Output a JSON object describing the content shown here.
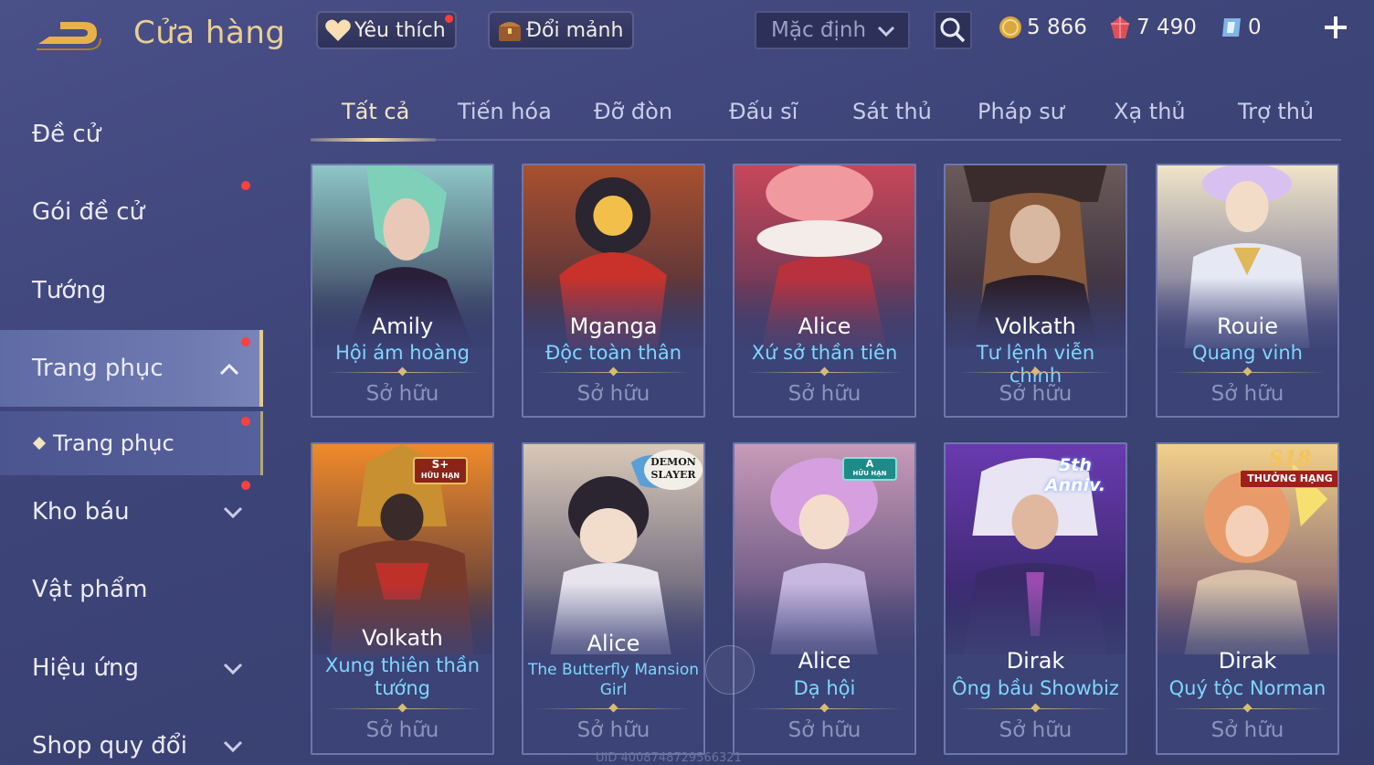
{
  "header": {
    "title": "Cửa hàng",
    "favorites_label": "Yêu thích",
    "exchange_label": "Đổi mảnh",
    "sort": {
      "selected": "Mặc định"
    },
    "currencies": [
      {
        "icon": "gold-coin-icon",
        "value": "5 866"
      },
      {
        "icon": "red-gem-icon",
        "value": "7 490"
      },
      {
        "icon": "voucher-icon",
        "value": "0"
      }
    ]
  },
  "sidebar": {
    "items": [
      {
        "label": "Đề cử"
      },
      {
        "label": "Gói đề cử"
      },
      {
        "label": "Tướng"
      },
      {
        "label": "Trang phục"
      },
      {
        "label": "Trang phục"
      },
      {
        "label": "Kho báu"
      },
      {
        "label": "Vật phẩm"
      },
      {
        "label": "Hiệu ứng"
      },
      {
        "label": "Shop quy đổi"
      }
    ]
  },
  "tabs": [
    "Tất cả",
    "Tiến hóa",
    "Đỡ đòn",
    "Đấu sĩ",
    "Sát thủ",
    "Pháp sư",
    "Xạ thủ",
    "Trợ thủ"
  ],
  "cards": [
    {
      "hero": "Amily",
      "skin": "Hội ám hoàng",
      "status": "Sở hữu"
    },
    {
      "hero": "Mganga",
      "skin": "Độc toàn thân",
      "status": "Sở hữu"
    },
    {
      "hero": "Alice",
      "skin": "Xứ sở thần tiên",
      "status": "Sở hữu"
    },
    {
      "hero": "Volkath",
      "skin": "Tư lệnh viễn chinh",
      "status": "Sở hữu"
    },
    {
      "hero": "Rouie",
      "skin": "Quang vinh",
      "status": "Sở hữu"
    },
    {
      "hero": "Volkath",
      "skin": "Xung thiên thần tướng",
      "status": "Sở hữu",
      "badge": "S+",
      "badge_sub": "HỮU HẠN"
    },
    {
      "hero": "Alice",
      "skin": "The Butterfly Mansion Girl",
      "status": "Sở hữu",
      "badge": "DEMON SLAYER"
    },
    {
      "hero": "Alice",
      "skin": "Dạ hội",
      "status": "Sở hữu",
      "badge": "A",
      "badge_sub": "HỮU HẠN"
    },
    {
      "hero": "Dirak",
      "skin": "Ông bầu Showbiz",
      "status": "Sở hữu",
      "badge": "5th Anniv."
    },
    {
      "hero": "Dirak",
      "skin": "Quý tộc Norman",
      "status": "Sở hữu",
      "badge": "S18",
      "badge_sub": "THƯỞNG HẠNG"
    }
  ],
  "footer": {
    "uid": "UID 4008748729566321"
  },
  "colors": {
    "accent_gold": "#e9cf94",
    "skin_name": "#7fd6ff",
    "notification": "#ff3b3b"
  }
}
